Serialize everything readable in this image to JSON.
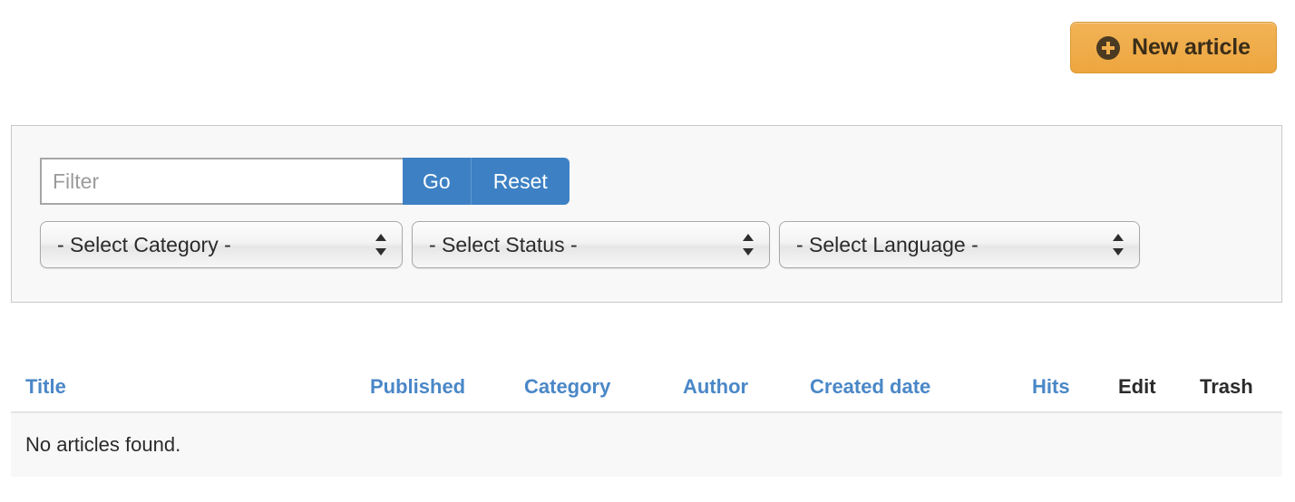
{
  "toolbar": {
    "new_article_label": "New article",
    "new_article_icon": "plus-circle-icon",
    "accent_color": "#eda63f"
  },
  "filter": {
    "search_placeholder": "Filter",
    "search_value": "",
    "go_label": "Go",
    "reset_label": "Reset",
    "button_color": "#3d81c4",
    "selects": [
      {
        "name": "category",
        "selected": "- Select Category -"
      },
      {
        "name": "status",
        "selected": "- Select Status -"
      },
      {
        "name": "language",
        "selected": "- Select Language -"
      }
    ]
  },
  "table": {
    "columns": [
      {
        "label": "Title",
        "sortable": true
      },
      {
        "label": "Published",
        "sortable": true
      },
      {
        "label": "Category",
        "sortable": true
      },
      {
        "label": "Author",
        "sortable": true
      },
      {
        "label": "Created date",
        "sortable": true
      },
      {
        "label": "Hits",
        "sortable": true
      },
      {
        "label": "Edit",
        "sortable": false
      },
      {
        "label": "Trash",
        "sortable": false
      }
    ],
    "rows": [],
    "empty_message": "No articles found.",
    "link_color": "#4a87c7"
  }
}
